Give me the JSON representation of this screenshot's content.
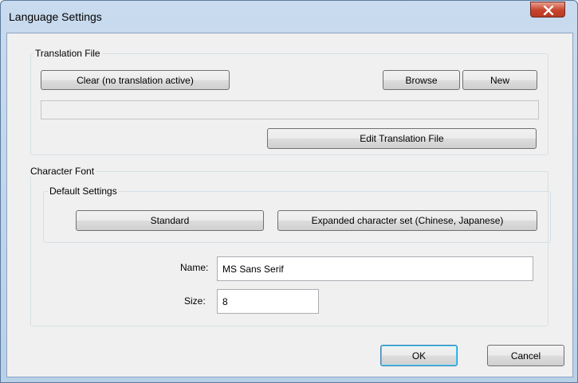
{
  "window": {
    "title": "Language Settings"
  },
  "translation": {
    "group_label": "Translation File",
    "clear_label": "Clear (no translation active)",
    "browse_label": "Browse",
    "new_label": "New",
    "path_value": "",
    "edit_label": "Edit Translation File"
  },
  "font": {
    "group_label": "Character Font",
    "defaults_label": "Default Settings",
    "standard_label": "Standard",
    "expanded_label": "Expanded character set (Chinese, Japanese)",
    "name_label": "Name:",
    "name_value": "MS Sans Serif",
    "size_label": "Size:",
    "size_value": "8"
  },
  "footer": {
    "ok_label": "OK",
    "cancel_label": "Cancel"
  },
  "icons": {
    "close": "close-icon"
  }
}
